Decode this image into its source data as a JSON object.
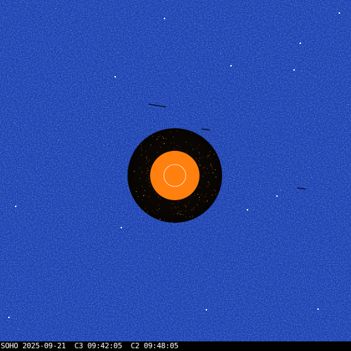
{
  "image": {
    "caption": "SOHO 2025-09-21  C3 09:42:05  C2 09:48:05",
    "colors": {
      "background": "#1c3fb3",
      "occulter": "#0a0704",
      "sun_disk": "#ff7f0f",
      "solar_limb_outline": "#ffffff",
      "stars": "#ffffff",
      "caption_text": "#ffffff",
      "caption_bar": "#000000"
    },
    "icons": {
      "outer_occulter": "dark-occulter-disk",
      "inner_marker": "orange-sun-disk",
      "limb": "white-circle-outline"
    }
  }
}
